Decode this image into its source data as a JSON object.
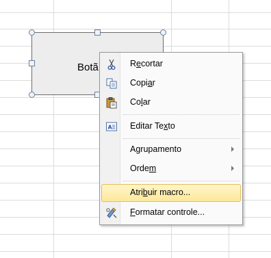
{
  "form_button": {
    "label": "Botã"
  },
  "context_menu": {
    "items": [
      {
        "pre": "R",
        "u": "e",
        "post": "cortar",
        "icon": "scissors-icon"
      },
      {
        "pre": "Copi",
        "u": "a",
        "post": "r",
        "icon": "copy-icon"
      },
      {
        "pre": "Co",
        "u": "l",
        "post": "ar",
        "icon": "paste-icon"
      },
      {
        "pre": "Editar Te",
        "u": "x",
        "post": "to",
        "icon": "edit-text-icon"
      },
      {
        "pre": "A",
        "u": "g",
        "post": "rupamento",
        "submenu": true
      },
      {
        "pre": "Orde",
        "u": "m",
        "post": "",
        "submenu": true
      },
      {
        "pre": "Atri",
        "u": "b",
        "post": "uir macro...",
        "highlighted": true
      },
      {
        "pre": "",
        "u": "F",
        "post": "ormatar controle...",
        "icon": "format-control-icon"
      }
    ]
  }
}
